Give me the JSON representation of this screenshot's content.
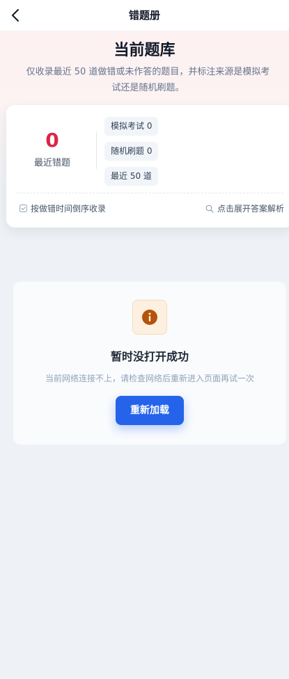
{
  "navbar": {
    "title": "错题册",
    "back_icon": "chevron-left-icon"
  },
  "hero": {
    "title": "当前题库",
    "description": "仅收录最近 50 道做错或未作答的题目，并标注来源是模拟考试还是随机刷题。"
  },
  "stats": {
    "count": "0",
    "count_label": "最近错题",
    "chips": [
      "模拟考试 0",
      "随机刷题 0",
      "最近 50 道"
    ],
    "sort_label": "按做错时间倒序收录",
    "expand_label": "点击展开答案解析"
  },
  "error": {
    "icon": "info-icon",
    "title": "暂时没打开成功",
    "description": "当前网络连接不上，请检查网络后重新进入页面再试一次",
    "reload_label": "重新加载"
  },
  "colors": {
    "accent": "#2563eb",
    "count_red": "#dc2647",
    "warning_orange": "#b45309"
  }
}
